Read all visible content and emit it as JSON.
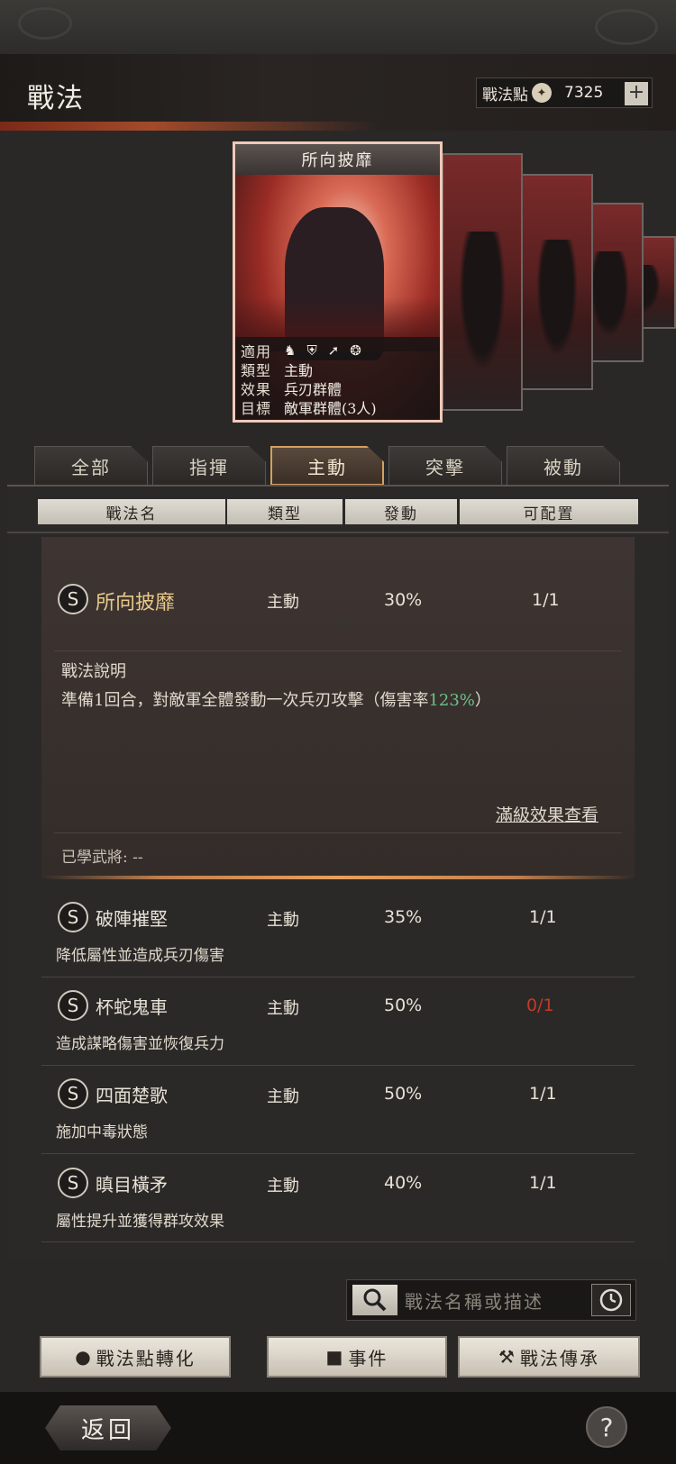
{
  "header": {
    "title": "戰法",
    "points_label": "戰法點",
    "points_value": "7325",
    "plus_label": "+"
  },
  "featured_card": {
    "name": "所向披靡",
    "rows": [
      {
        "key": "適用",
        "value": ""
      },
      {
        "key": "類型",
        "value": "主動"
      },
      {
        "key": "效果",
        "value": "兵刃群體"
      },
      {
        "key": "目標",
        "value": "敵軍群體(3人)"
      }
    ],
    "applicable_icons": [
      "cavalry-icon",
      "shield-icon",
      "archer-icon",
      "wheel-icon"
    ]
  },
  "tabs": [
    {
      "label": "全部",
      "active": false
    },
    {
      "label": "指揮",
      "active": false
    },
    {
      "label": "主動",
      "active": true
    },
    {
      "label": "突擊",
      "active": false
    },
    {
      "label": "被動",
      "active": false
    }
  ],
  "columns": [
    "戰法名",
    "類型",
    "發動",
    "可配置"
  ],
  "expanded": {
    "grade": "S",
    "name": "所向披靡",
    "type": "主動",
    "rate": "30%",
    "slots": "1/1",
    "desc_title": "戰法說明",
    "desc_prefix": "準備1回合，對敵軍全體發動一次兵刃攻擊（傷害率",
    "desc_value": "123%",
    "desc_suffix": "）",
    "max_link": "滿級效果查看",
    "learned_label": "已學武將:",
    "learned_value": "--"
  },
  "tactics": [
    {
      "grade": "S",
      "name": "破陣摧堅",
      "type": "主動",
      "rate": "35%",
      "slots": "1/1",
      "desc": "降低屬性並造成兵刃傷害",
      "slots_red": false
    },
    {
      "grade": "S",
      "name": "杯蛇鬼車",
      "type": "主動",
      "rate": "50%",
      "slots": "0/1",
      "desc": "造成謀略傷害並恢復兵力",
      "slots_red": true
    },
    {
      "grade": "S",
      "name": "四面楚歌",
      "type": "主動",
      "rate": "50%",
      "slots": "1/1",
      "desc": "施加中毒狀態",
      "slots_red": false
    },
    {
      "grade": "S",
      "name": "瞋目橫矛",
      "type": "主動",
      "rate": "40%",
      "slots": "1/1",
      "desc": "屬性提升並獲得群攻效果",
      "slots_red": false
    }
  ],
  "search": {
    "placeholder": "戰法名稱或描述"
  },
  "buttons": {
    "convert": "戰法點轉化",
    "events": "事件",
    "inherit": "戰法傳承",
    "back": "返回",
    "help": "?"
  },
  "colors": {
    "accent_gold": "#e8c88a",
    "red": "#c23a2a",
    "green": "#6cc08a",
    "active_tab_border": "#d4a060"
  }
}
